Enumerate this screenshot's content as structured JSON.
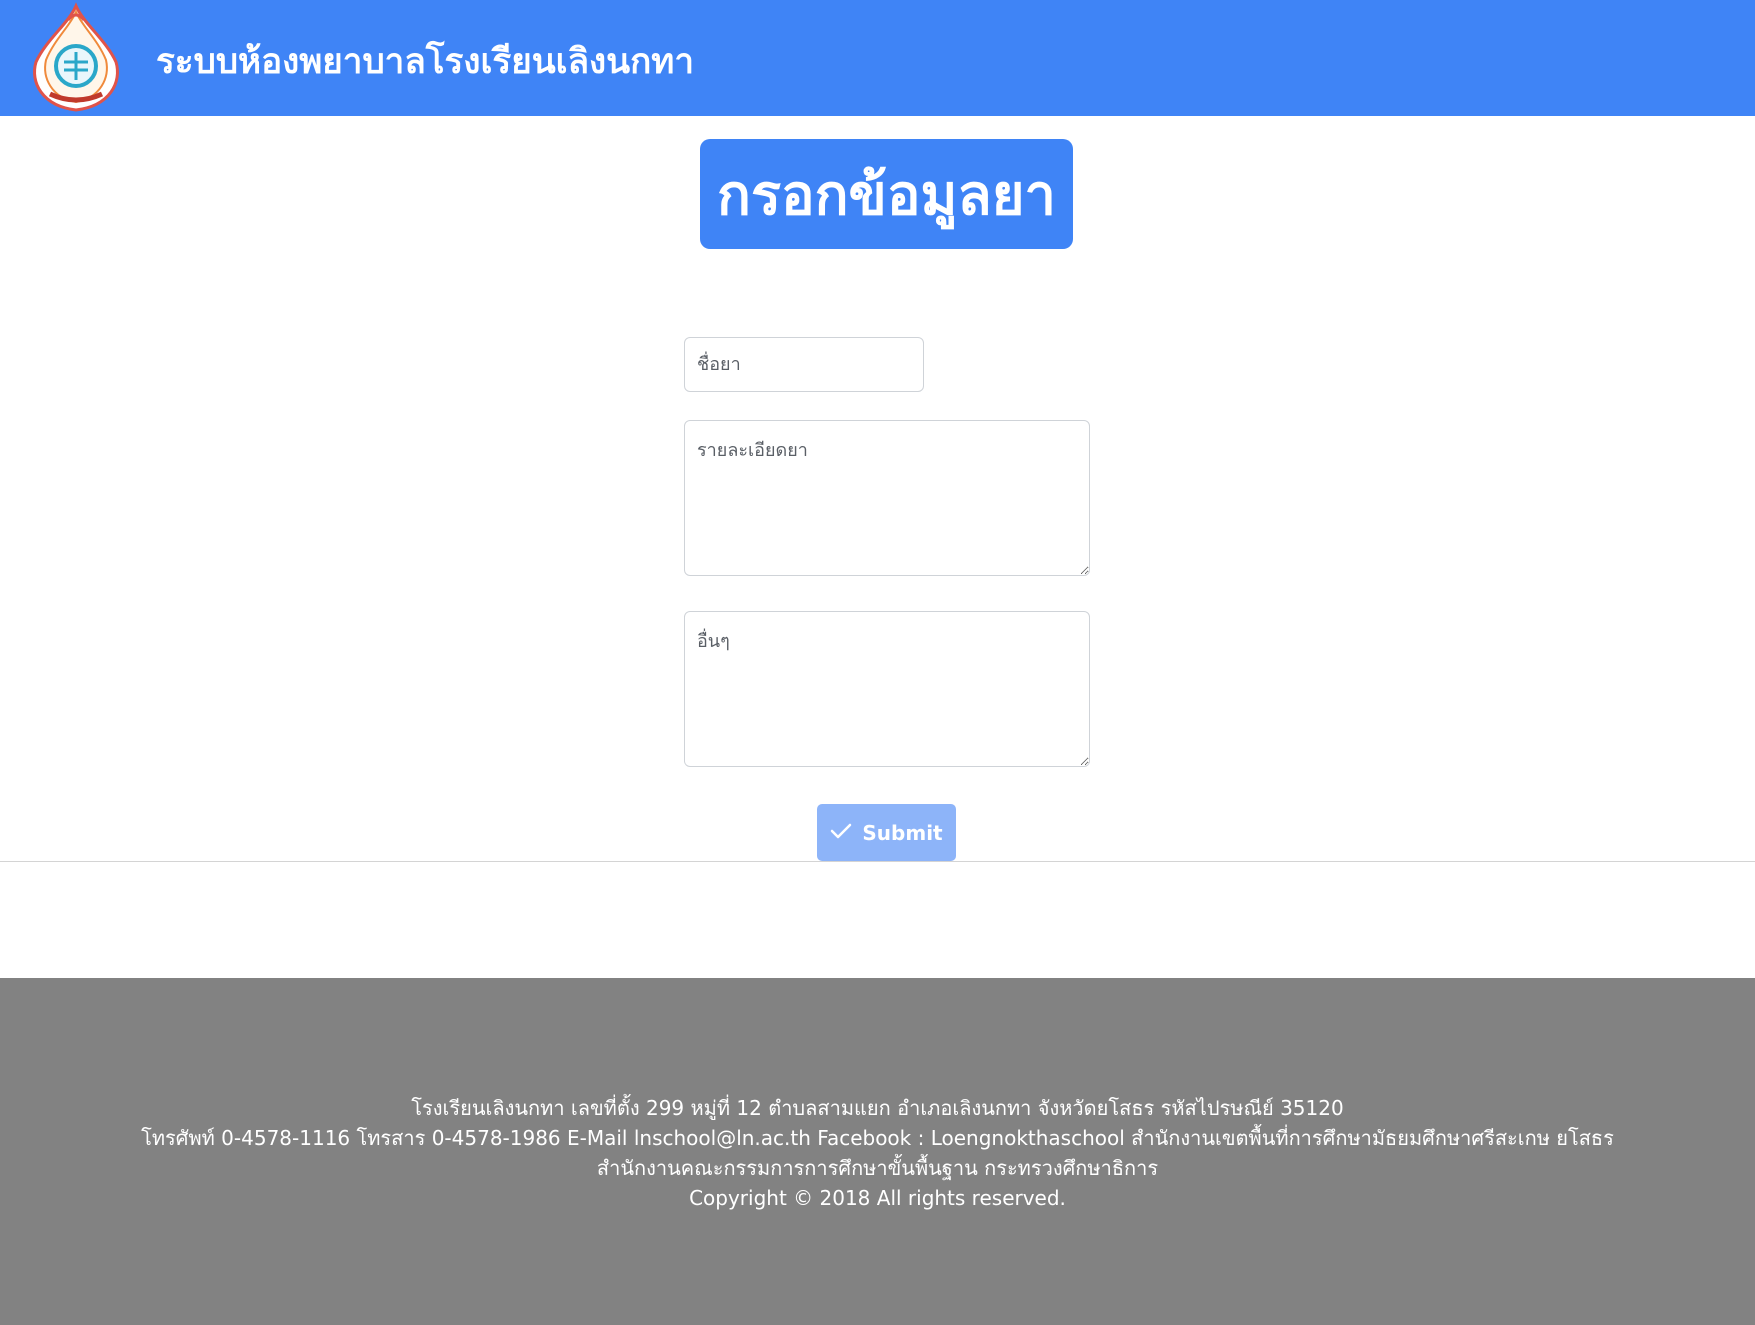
{
  "header": {
    "title": "ระบบห้องพยาบาลโรงเรียนเลิงนกทา",
    "logo_icon": "school-emblem-logo",
    "background": "#3f84f6"
  },
  "main": {
    "heading": "กรอกข้อมูลยา",
    "fields": {
      "drug_name": {
        "placeholder": "ชื่อยา",
        "value": ""
      },
      "drug_detail": {
        "placeholder": "รายละเอียดยา",
        "value": ""
      },
      "drug_other": {
        "placeholder": "อื่นๆ",
        "value": ""
      }
    },
    "submit": {
      "label": "Submit",
      "icon": "check-icon",
      "color": "#8db4f9"
    }
  },
  "footer": {
    "line1": "โรงเรียนเลิงนกทา เลขที่ตั้ง 299 หมู่ที่ 12 ตำบลสามแยก อำเภอเลิงนกทา จังหวัดยโสธร รหัสไปรษณีย์ 35120",
    "line2": "โทรศัพท์ 0-4578-1116 โทรสาร 0-4578-1986 E-Mail lnschool@ln.ac.th Facebook : Loengnokthaschool สำนักงานเขตพื้นที่การศึกษามัธยมศึกษาศรีสะเกษ ยโสธร",
    "line3": "สำนักงานคณะกรรมการการศึกษาขั้นพื้นฐาน กระทรวงศึกษาธิการ",
    "line4": "Copyright © 2018 All rights reserved.",
    "background": "#828282"
  }
}
